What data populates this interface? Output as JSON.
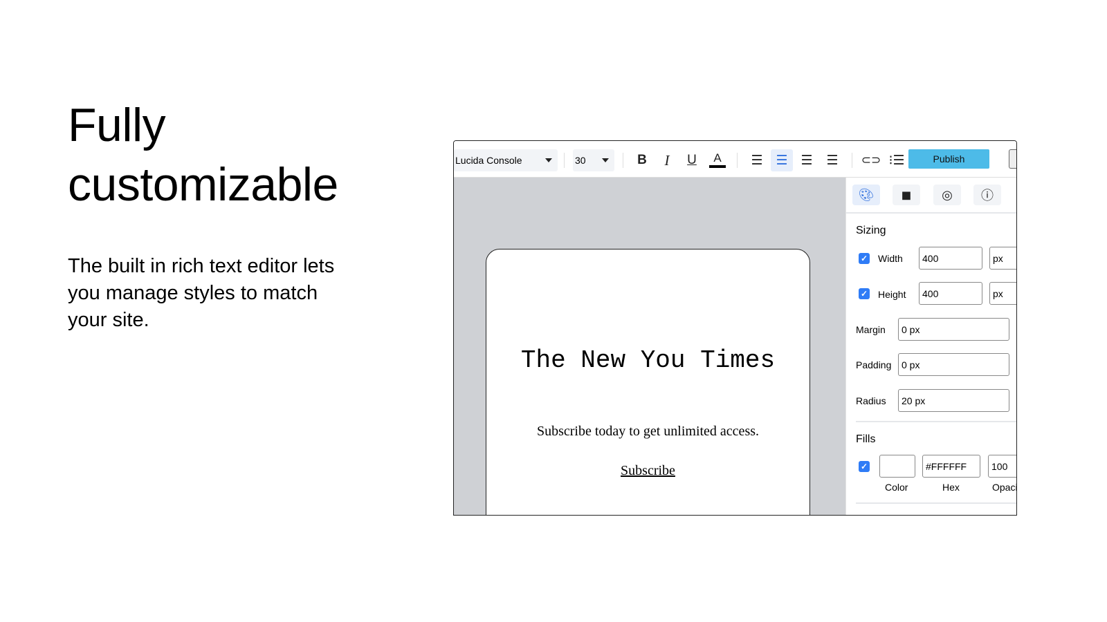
{
  "hero": {
    "title_line1": "Fully",
    "title_line2": "customizable",
    "description": "The built in rich text editor lets you manage styles to match your site."
  },
  "toolbar": {
    "font_family": "Lucida Console",
    "font_size": "30",
    "publish_label": "Publish",
    "icons": [
      "bold-icon",
      "italic-icon",
      "underline-icon",
      "text-color-icon",
      "align-left-icon",
      "align-center-icon",
      "align-right-icon",
      "align-justify-icon",
      "link-icon",
      "list-icon"
    ],
    "active_alignment": "center"
  },
  "canvas": {
    "title": "The New You Times",
    "subtitle": "Subscribe today to get unlimited access.",
    "link": "Subscribe"
  },
  "panel": {
    "tabs": [
      "palette-icon",
      "layers-icon",
      "target-icon",
      "info-icon"
    ],
    "active_tab": "palette-icon",
    "sizing": {
      "heading": "Sizing",
      "width": {
        "label": "Width",
        "checked": true,
        "value": "400",
        "unit": "px"
      },
      "height": {
        "label": "Height",
        "checked": true,
        "value": "400",
        "unit": "px"
      },
      "margin": {
        "label": "Margin",
        "value": "0 px"
      },
      "padding": {
        "label": "Padding",
        "value": "0 px"
      },
      "radius": {
        "label": "Radius",
        "value": "20 px"
      }
    },
    "fills": {
      "heading": "Fills",
      "checked": true,
      "color": "#FFFFFF",
      "hex": "#FFFFFF",
      "opacity": "100",
      "color_label": "Color",
      "hex_label": "Hex",
      "opacity_label": "Opacity"
    }
  },
  "colors": {
    "accent": "#2f7cf6",
    "publish": "#4dbbe8",
    "canvas_bg": "#cfd1d5"
  }
}
